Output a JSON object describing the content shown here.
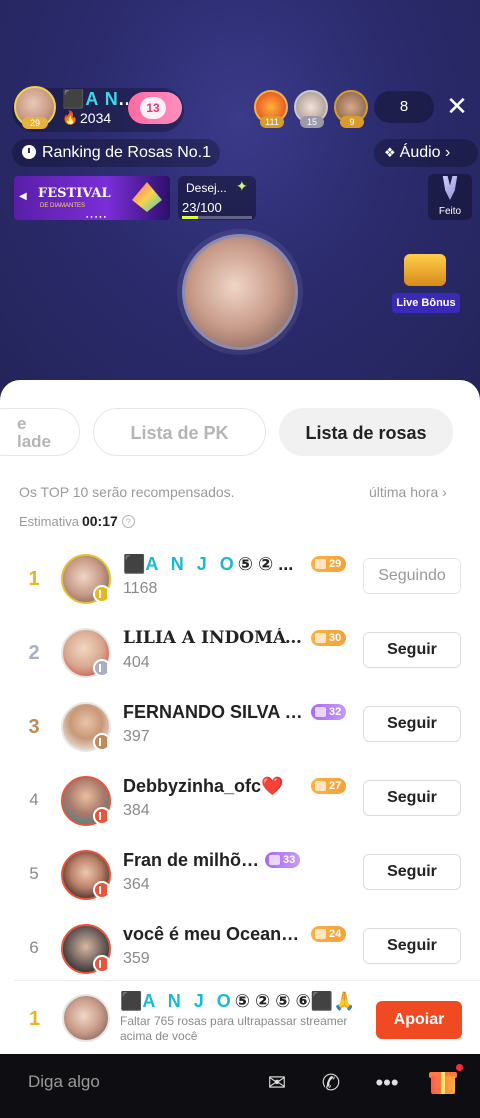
{
  "header": {
    "host_name_prefix": "⬛",
    "host_name_cyan": "A N",
    "host_name_tail": "...",
    "host_level": "29",
    "host_fire_icon": "fire-icon",
    "host_rose_count": "2034",
    "follow_badge": "13",
    "viewers": [
      {
        "level": "111"
      },
      {
        "level": "15"
      },
      {
        "level": "9"
      }
    ],
    "viewer_count": "8",
    "close": "✕"
  },
  "ranking_pill": "Ranking de Rosas No.1",
  "audio_pill": "Áudio",
  "banners": {
    "festival_title": "FESTIVAL",
    "festival_sub": "DE DIAMANTES",
    "wish_label": "Desej...",
    "wish_progress": "23/100",
    "wish_fraction": 0.23,
    "done_label": "Feito",
    "live_bonus": "Live Bônus"
  },
  "tabs": {
    "cut_label_1": "e",
    "cut_label_2": "lade",
    "pk": "Lista de PK",
    "rosas": "Lista de rosas"
  },
  "info": {
    "top10_hint": "Os TOP 10 serão recompensados.",
    "last_hour": "última hora",
    "estimate_label": "Estimativa",
    "estimate_time": "00:17",
    "help": "?"
  },
  "ranking": [
    {
      "rank": "1",
      "name_prefix": "⬛",
      "name_cyan": "A N J O",
      "name_tail": "⑤ ② ...",
      "score": "1168",
      "level": "29",
      "level_color": "orange",
      "button": "Seguindo",
      "following": true
    },
    {
      "rank": "2",
      "name": "LILIA A INDOMÁV...",
      "score": "404",
      "level": "30",
      "level_color": "orange",
      "button": "Seguir",
      "following": false
    },
    {
      "rank": "3",
      "name": "FERNANDO SILVA O...",
      "score": "397",
      "level": "32",
      "level_color": "purple",
      "button": "Seguir",
      "following": false
    },
    {
      "rank": "4",
      "name": "Debbyzinha_ofc❤️",
      "score": "384",
      "level": "27",
      "level_color": "orange",
      "button": "Seguir",
      "following": false
    },
    {
      "rank": "5",
      "name": "Fran de milhões",
      "score": "364",
      "level": "33",
      "level_color": "purple",
      "button": "Seguir",
      "following": false
    },
    {
      "rank": "6",
      "name": "você é meu Oceano...",
      "score": "359",
      "level": "24",
      "level_color": "orange",
      "button": "Seguir",
      "following": false
    }
  ],
  "my_rank": {
    "rank": "1",
    "name_prefix": "⬛",
    "name_cyan": "A N J O",
    "name_tail": "⑤ ② ⑤ ⑥⬛🙏...",
    "hint": "Faltar 765 rosas para ultrapassar streamer acima de você",
    "button": "Apoiar"
  },
  "bottom_bar": {
    "placeholder": "Diga algo",
    "icons": [
      "share-icon",
      "call-icon",
      "more-icon",
      "gift-icon"
    ]
  }
}
